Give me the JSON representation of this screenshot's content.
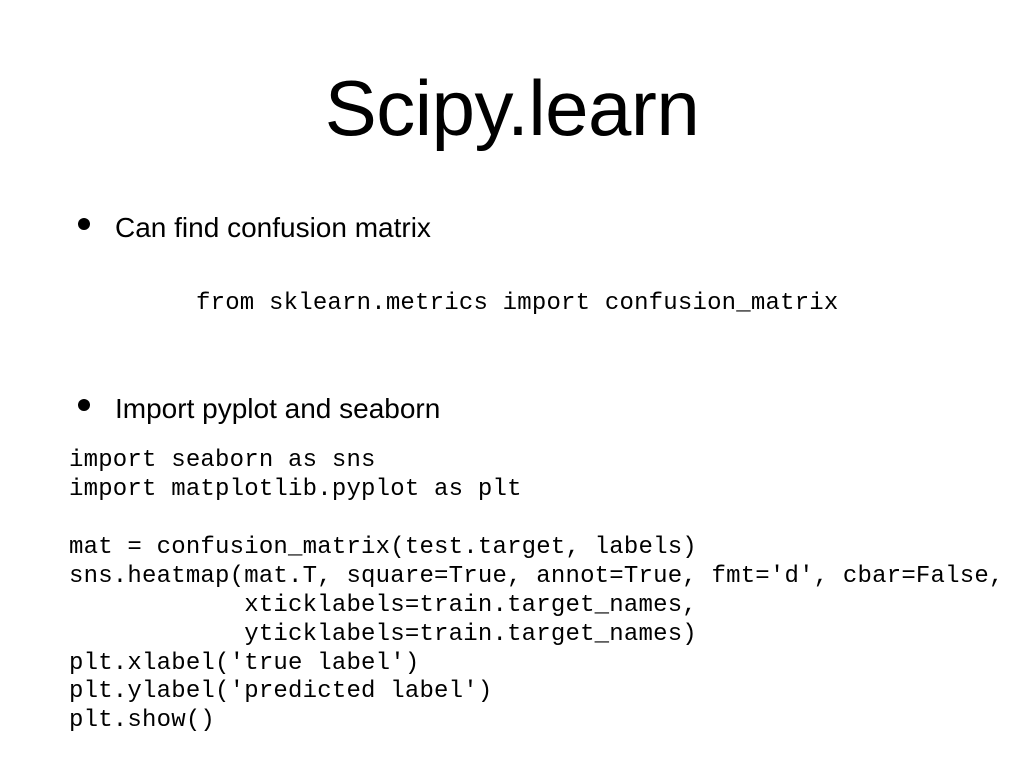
{
  "slide": {
    "title": "Scipy.learn",
    "bullets": [
      {
        "text": "Can find confusion matrix",
        "code": [
          "from sklearn.metrics import confusion_matrix"
        ]
      },
      {
        "text": "Import pyplot and seaborn",
        "code_imports": [
          "import seaborn as sns",
          "import matplotlib.pyplot as plt"
        ],
        "code_main": [
          "mat = confusion_matrix(test.target, labels)",
          "sns.heatmap(mat.T, square=True, annot=True, fmt='d', cbar=False,",
          "            xticklabels=train.target_names,",
          "            yticklabels=train.target_names)",
          "plt.xlabel('true label')",
          "plt.ylabel('predicted label')",
          "plt.show()"
        ]
      }
    ]
  }
}
